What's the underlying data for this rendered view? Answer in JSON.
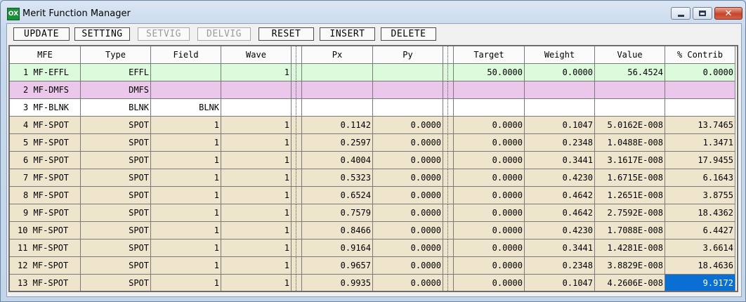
{
  "window": {
    "title": "Merit Function Manager",
    "icon_text": "OX"
  },
  "toolbar": {
    "buttons": [
      {
        "label": "UPDATE",
        "enabled": true
      },
      {
        "label": "SETTING",
        "enabled": true
      },
      {
        "label": "SETVIG",
        "enabled": false
      },
      {
        "label": "DELVIG",
        "enabled": false
      },
      {
        "label": "RESET",
        "enabled": true
      },
      {
        "label": "INSERT",
        "enabled": true
      },
      {
        "label": "DELETE",
        "enabled": true
      }
    ]
  },
  "table": {
    "headers": [
      "MFE",
      "Type",
      "Field",
      "Wave",
      "Px",
      "Py",
      "Target",
      "Weight",
      "Value",
      "% Contrib"
    ],
    "rows": [
      {
        "mfe": "1 MF-EFFL",
        "type": "EFFL",
        "field": "",
        "wave": "1",
        "px": "",
        "py": "",
        "target": "50.0000",
        "weight": "0.0000",
        "value": "56.4524",
        "contrib": "0.0000",
        "color": "#dcfbdc"
      },
      {
        "mfe": "2 MF-DMFS",
        "type": "DMFS",
        "field": "",
        "wave": "",
        "px": "",
        "py": "",
        "target": "",
        "weight": "",
        "value": "",
        "contrib": "",
        "color": "#ebc7eb"
      },
      {
        "mfe": "3 MF-BLNK",
        "type": "BLNK",
        "field": "BLNK",
        "wave": "",
        "px": "",
        "py": "",
        "target": "",
        "weight": "",
        "value": "",
        "contrib": "",
        "color": "#ffffff"
      },
      {
        "mfe": "4 MF-SPOT",
        "type": "SPOT",
        "field": "1",
        "wave": "1",
        "px": "0.1142",
        "py": "0.0000",
        "target": "0.0000",
        "weight": "0.1047",
        "value": "5.0162E-008",
        "contrib": "13.7465",
        "color": "#efe5cc"
      },
      {
        "mfe": "5 MF-SPOT",
        "type": "SPOT",
        "field": "1",
        "wave": "1",
        "px": "0.2597",
        "py": "0.0000",
        "target": "0.0000",
        "weight": "0.2348",
        "value": "1.0488E-008",
        "contrib": "1.3471",
        "color": "#efe5cc"
      },
      {
        "mfe": "6 MF-SPOT",
        "type": "SPOT",
        "field": "1",
        "wave": "1",
        "px": "0.4004",
        "py": "0.0000",
        "target": "0.0000",
        "weight": "0.3441",
        "value": "3.1617E-008",
        "contrib": "17.9455",
        "color": "#efe5cc"
      },
      {
        "mfe": "7 MF-SPOT",
        "type": "SPOT",
        "field": "1",
        "wave": "1",
        "px": "0.5323",
        "py": "0.0000",
        "target": "0.0000",
        "weight": "0.4230",
        "value": "1.6715E-008",
        "contrib": "6.1643",
        "color": "#efe5cc"
      },
      {
        "mfe": "8 MF-SPOT",
        "type": "SPOT",
        "field": "1",
        "wave": "1",
        "px": "0.6524",
        "py": "0.0000",
        "target": "0.0000",
        "weight": "0.4642",
        "value": "1.2651E-008",
        "contrib": "3.8755",
        "color": "#efe5cc"
      },
      {
        "mfe": "9 MF-SPOT",
        "type": "SPOT",
        "field": "1",
        "wave": "1",
        "px": "0.7579",
        "py": "0.0000",
        "target": "0.0000",
        "weight": "0.4642",
        "value": "2.7592E-008",
        "contrib": "18.4362",
        "color": "#efe5cc"
      },
      {
        "mfe": "10 MF-SPOT",
        "type": "SPOT",
        "field": "1",
        "wave": "1",
        "px": "0.8466",
        "py": "0.0000",
        "target": "0.0000",
        "weight": "0.4230",
        "value": "1.7088E-008",
        "contrib": "6.4427",
        "color": "#efe5cc"
      },
      {
        "mfe": "11 MF-SPOT",
        "type": "SPOT",
        "field": "1",
        "wave": "1",
        "px": "0.9164",
        "py": "0.0000",
        "target": "0.0000",
        "weight": "0.3441",
        "value": "1.4281E-008",
        "contrib": "3.6614",
        "color": "#efe5cc"
      },
      {
        "mfe": "12 MF-SPOT",
        "type": "SPOT",
        "field": "1",
        "wave": "1",
        "px": "0.9657",
        "py": "0.0000",
        "target": "0.0000",
        "weight": "0.2348",
        "value": "3.8829E-008",
        "contrib": "18.4636",
        "color": "#efe5cc"
      },
      {
        "mfe": "13 MF-SPOT",
        "type": "SPOT",
        "field": "1",
        "wave": "1",
        "px": "0.9935",
        "py": "0.0000",
        "target": "0.0000",
        "weight": "0.1047",
        "value": "4.2606E-008",
        "contrib": "9.9172",
        "color": "#efe5cc"
      }
    ],
    "selected_cell": {
      "row": 12,
      "column": "contrib"
    },
    "selection_color": "#0a6fd4"
  }
}
